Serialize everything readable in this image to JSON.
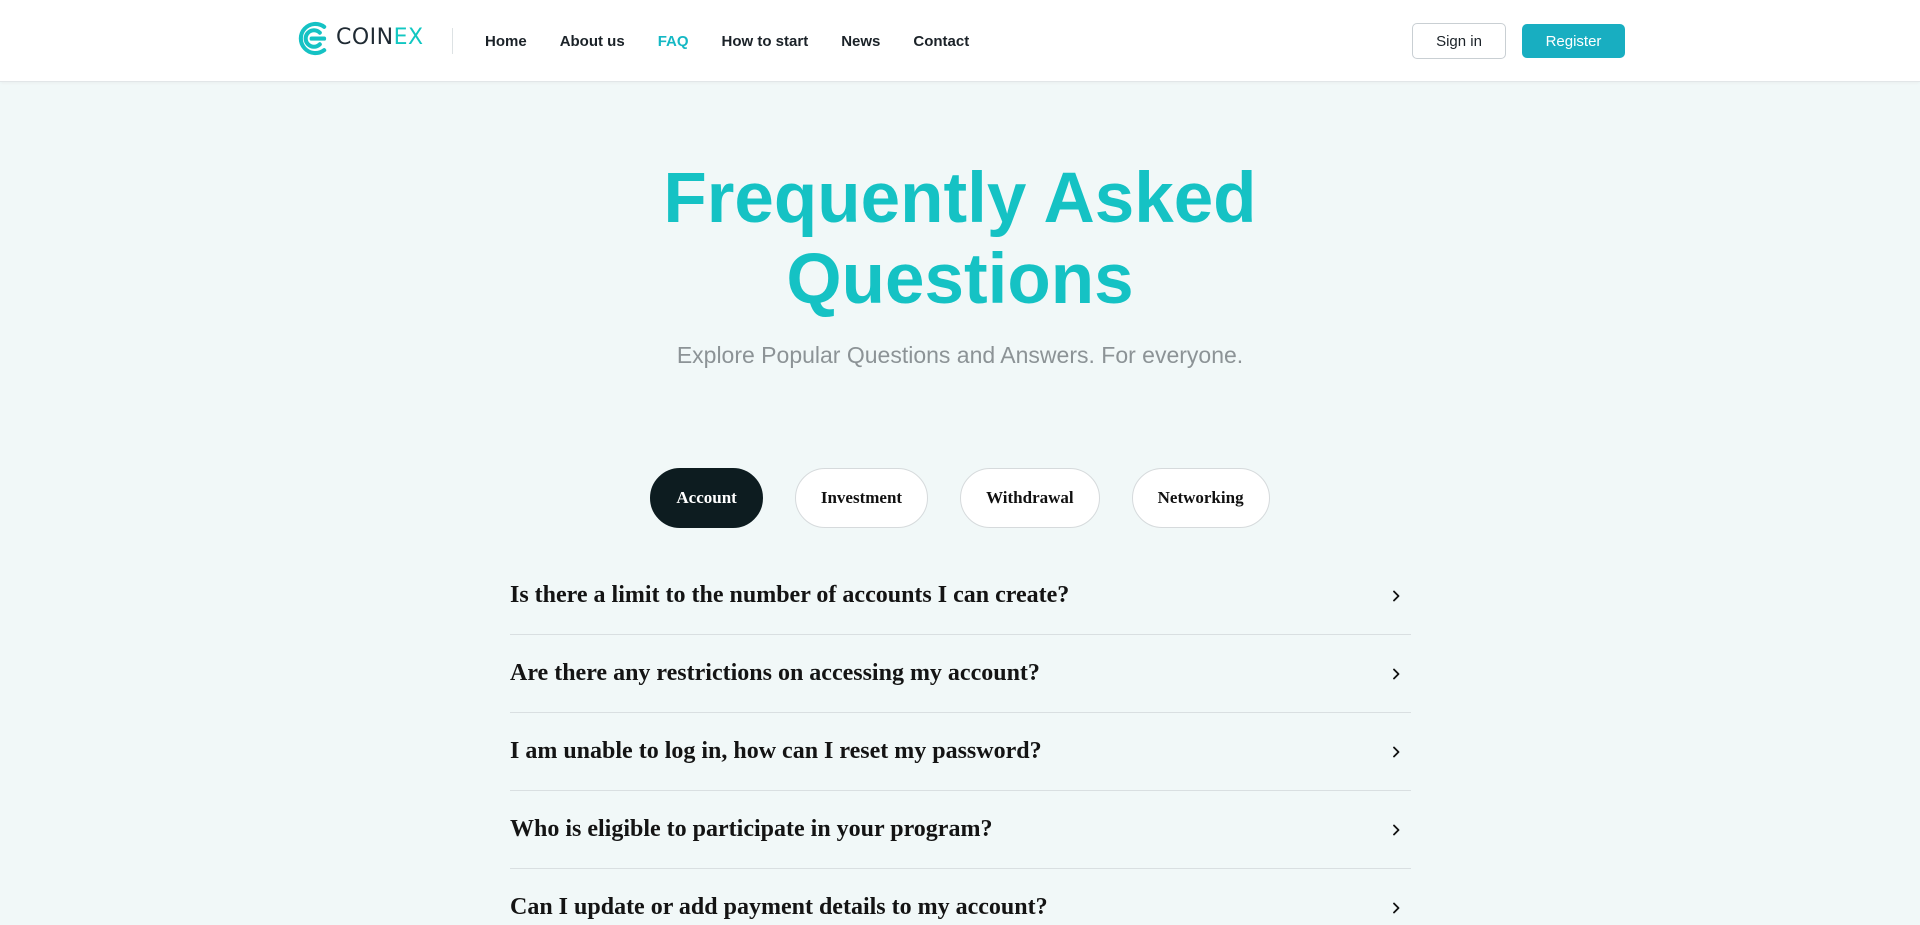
{
  "brand": {
    "name_part1": "COIN",
    "name_part2": "EX",
    "accent": "#15c2c4",
    "primary_button": "#18aec1",
    "dark": "#0d1c20"
  },
  "nav": {
    "items": [
      {
        "label": "Home",
        "active": false
      },
      {
        "label": "About us",
        "active": false
      },
      {
        "label": "FAQ",
        "active": true
      },
      {
        "label": "How to start",
        "active": false
      },
      {
        "label": "News",
        "active": false
      },
      {
        "label": "Contact",
        "active": false
      }
    ],
    "signin_label": "Sign in",
    "register_label": "Register"
  },
  "hero": {
    "title_line1": "Frequently Asked",
    "title_line2": "Questions",
    "subtitle": "Explore Popular Questions and Answers. For everyone."
  },
  "tabs": [
    {
      "label": "Account",
      "active": true
    },
    {
      "label": "Investment",
      "active": false
    },
    {
      "label": "Withdrawal",
      "active": false
    },
    {
      "label": "Networking",
      "active": false
    }
  ],
  "faq": {
    "items": [
      {
        "question": "Is there a limit to the number of accounts I can create?",
        "icon": "chevron-right-icon"
      },
      {
        "question": "Are there any restrictions on accessing my account?",
        "icon": "chevron-right-icon"
      },
      {
        "question": "I am unable to log in, how can I reset my password?",
        "icon": "chevron-right-icon"
      },
      {
        "question": "Who is eligible to participate in your program?",
        "icon": "chevron-right-icon"
      },
      {
        "question": "Can I update or add payment details to my account?",
        "icon": "chevron-right-icon"
      }
    ]
  }
}
